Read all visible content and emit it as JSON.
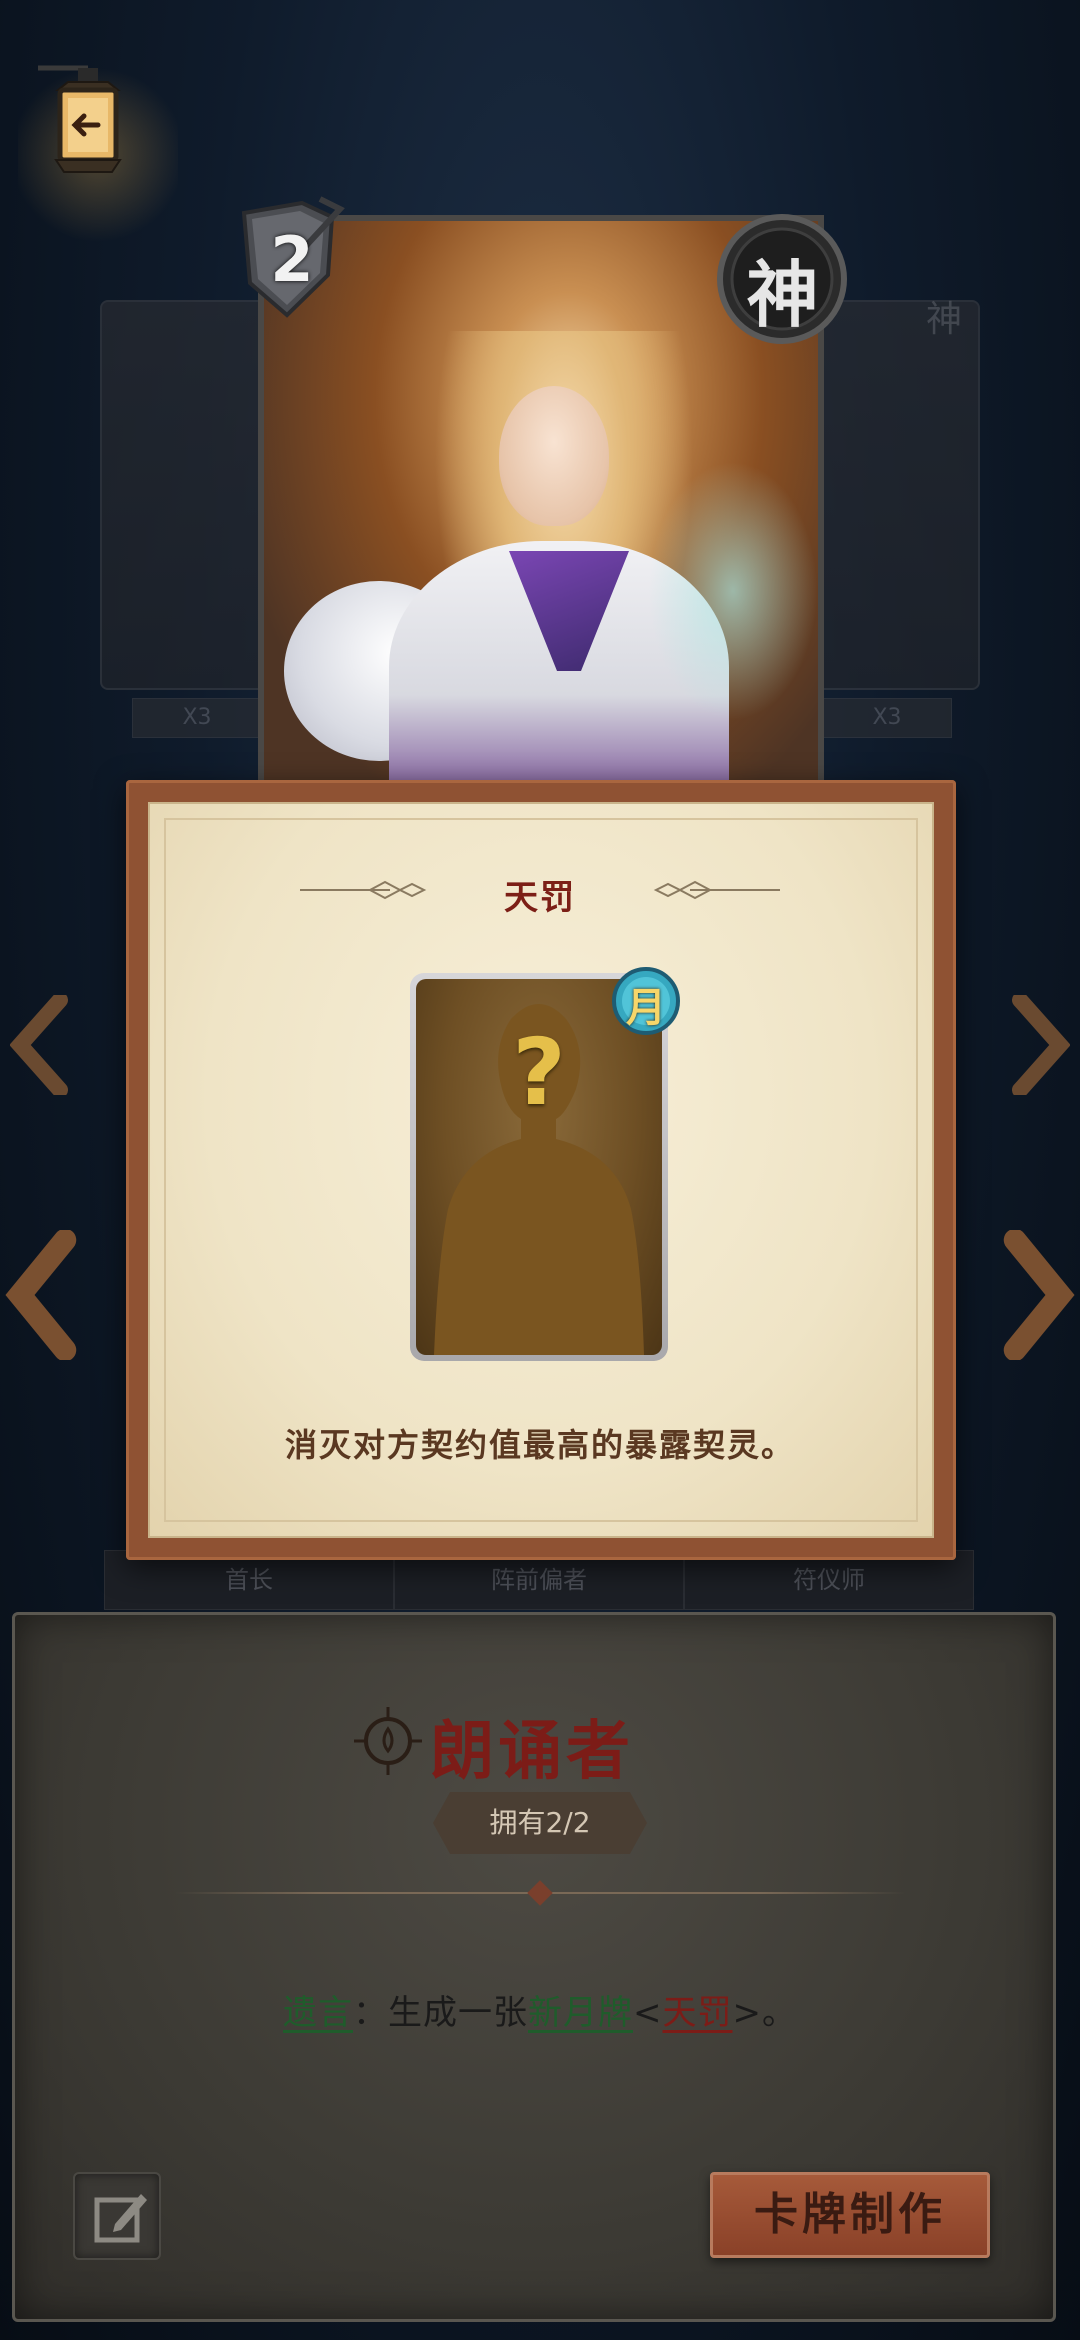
{
  "background_cards": {
    "left_count": "X3",
    "right_count": "X3",
    "right_badge": "神"
  },
  "hero_card": {
    "cost": "2",
    "class_badge": "神"
  },
  "popup": {
    "title": "天罚",
    "card_badge": "月",
    "description": "消灭对方契约值最高的暴露契灵。"
  },
  "behind_tabs": [
    "首长",
    "阵前偏者",
    "符仪师"
  ],
  "detail": {
    "name": "朗诵者",
    "owned": "拥有2/2",
    "ability": {
      "keyword": "遗言",
      "separator": "：生成一张",
      "card_type": "新月牌",
      "open": "<",
      "card_name": "天罚",
      "close": ">。"
    },
    "craft_label": "卡牌制作"
  },
  "icons": {
    "back": "back-arrow-icon",
    "edit": "edit-icon",
    "left_nav": "chevron-left-icon",
    "right_nav": "chevron-right-icon"
  },
  "colors": {
    "title_red": "#7c1c17",
    "keyword_green": "#1f5c2b",
    "craft_button": "#a65a3a"
  }
}
